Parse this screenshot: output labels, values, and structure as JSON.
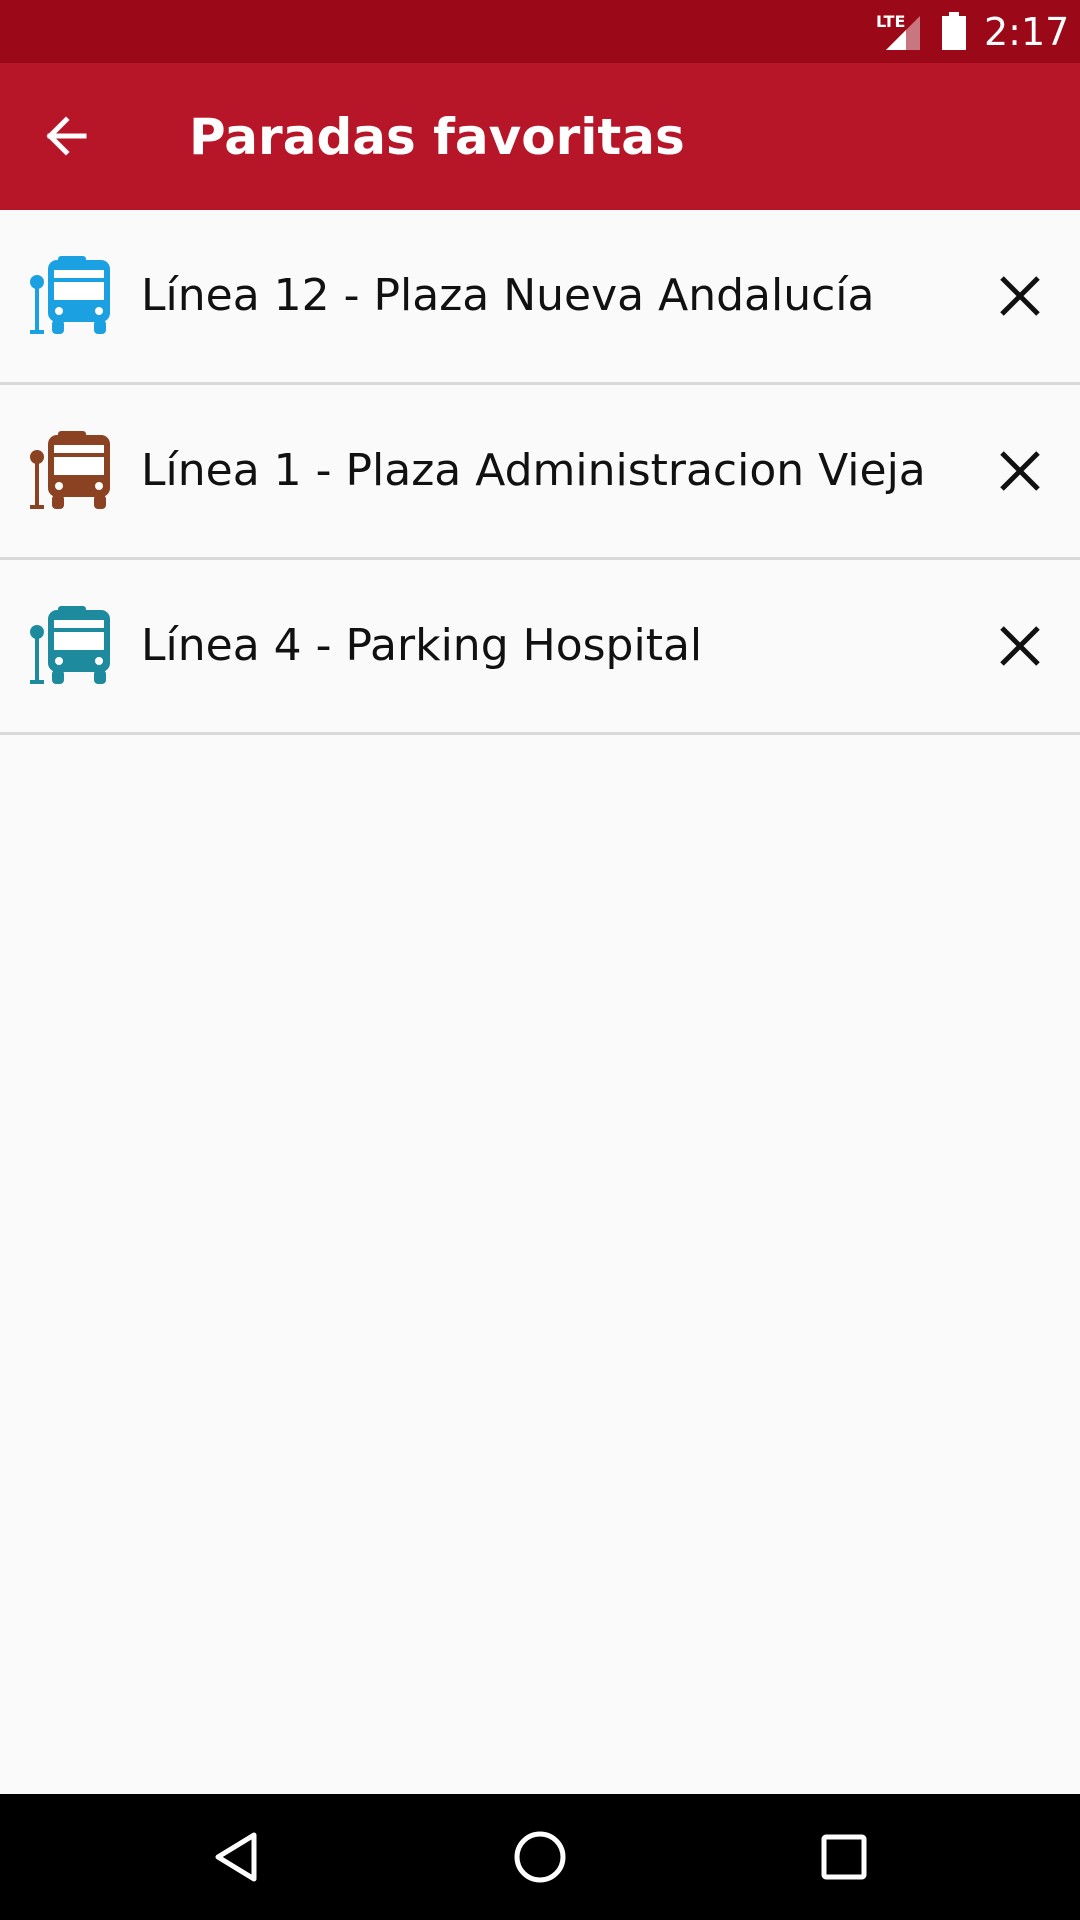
{
  "status_bar": {
    "network": "LTE",
    "time": "2:17",
    "icons": [
      "lte-signal-icon",
      "battery-icon"
    ]
  },
  "app_bar": {
    "title": "Paradas favoritas",
    "back_icon": "arrow-back-icon"
  },
  "favorites": [
    {
      "label": "Línea 12 - Plaza Nueva Andalucía",
      "icon": "bus-stop-icon",
      "color": "#1ba1e2",
      "remove_icon": "close-icon"
    },
    {
      "label": "Línea 1 - Plaza Administracion Vieja",
      "icon": "bus-stop-icon",
      "color": "#8b4222",
      "remove_icon": "close-icon"
    },
    {
      "label": "Línea 4 - Parking Hospital",
      "icon": "bus-stop-icon",
      "color": "#1e8a9e",
      "remove_icon": "close-icon"
    }
  ],
  "nav_bar": {
    "icons": [
      "back-triangle-icon",
      "home-circle-icon",
      "recents-square-icon"
    ]
  },
  "colors": {
    "status_bar": "#9b0818",
    "app_bar": "#b71528",
    "background": "#fafafa",
    "divider": "#d9d9d9"
  }
}
